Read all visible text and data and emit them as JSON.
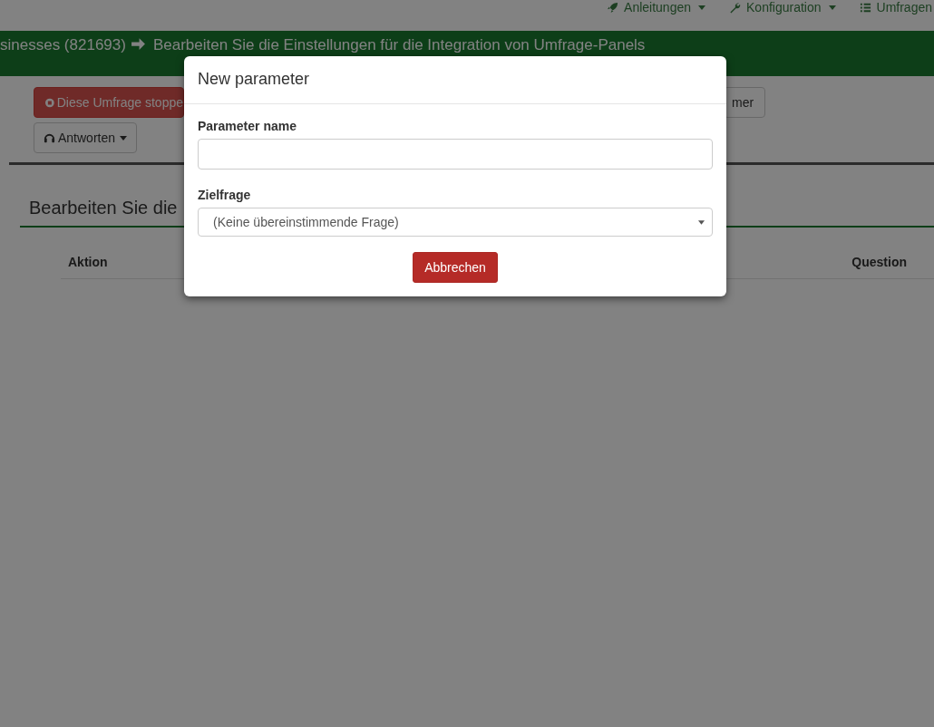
{
  "top_nav": [
    {
      "label": "Anleitungen",
      "caret": true
    },
    {
      "label": "Konfiguration",
      "caret": true
    },
    {
      "label": "Umfragen",
      "caret": false
    }
  ],
  "breadcrumb": {
    "parent": "sinesses (821693)",
    "current": "Bearbeiten Sie die Einstellungen für die Integration von Umfrage-Panels"
  },
  "toolbar": {
    "stop_button": "Diese Umfrage stoppe",
    "right_button": "mer",
    "responses_button": "Antworten"
  },
  "section_title": "Bearbeiten Sie die",
  "table": {
    "columns": [
      "Aktion",
      "Question"
    ]
  },
  "modal": {
    "title": "New parameter",
    "fields": [
      {
        "kind": "text",
        "label": "Parameter name"
      },
      {
        "kind": "select",
        "label": "Zielfrage",
        "value": "(Keine übereinstimmende Frage)"
      }
    ],
    "cancel_button": "Abbrechen"
  }
}
